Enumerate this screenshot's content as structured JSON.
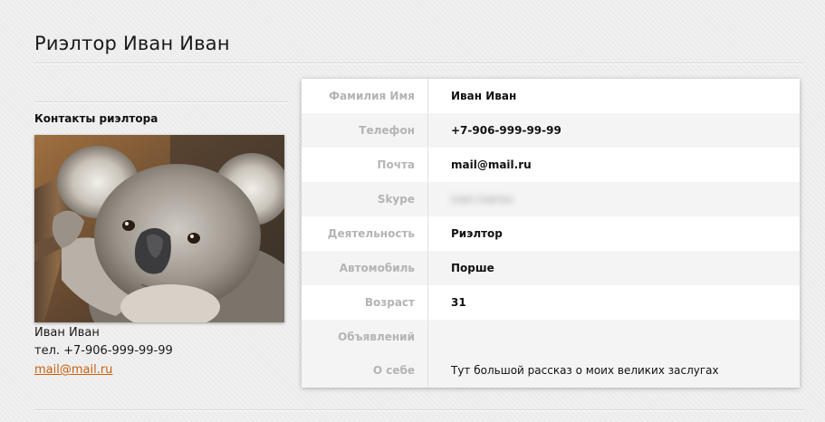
{
  "page": {
    "title": "Риэлтор Иван Иван"
  },
  "sidebar": {
    "heading": "Контакты риэлтора",
    "photo_subject": "koala-photo",
    "name": "Иван Иван",
    "phone": "тел. +7-906-999-99-99",
    "email": "mail@mail.ru"
  },
  "profile": {
    "rows": [
      {
        "label": "Фамилия Имя",
        "value": "Иван Иван"
      },
      {
        "label": "Телефон",
        "value": "+7-906-999-99-99"
      },
      {
        "label": "Почта",
        "value": "mail@mail.ru"
      },
      {
        "label": "Skype",
        "value": "ivan.ivanov"
      },
      {
        "label": "Деятельность",
        "value": "Риэлтор"
      },
      {
        "label": "Автомобиль",
        "value": "Порше"
      },
      {
        "label": "Возраст",
        "value": "31"
      },
      {
        "label": "Объявлений",
        "value": ""
      },
      {
        "label": "О себе",
        "value": "Тут большой рассказ о моих великих заслугах"
      }
    ]
  },
  "colors": {
    "link": "#c9600f",
    "label": "#b4b4b4",
    "background": "#ececec",
    "alt_row": "#f4f4f4"
  }
}
